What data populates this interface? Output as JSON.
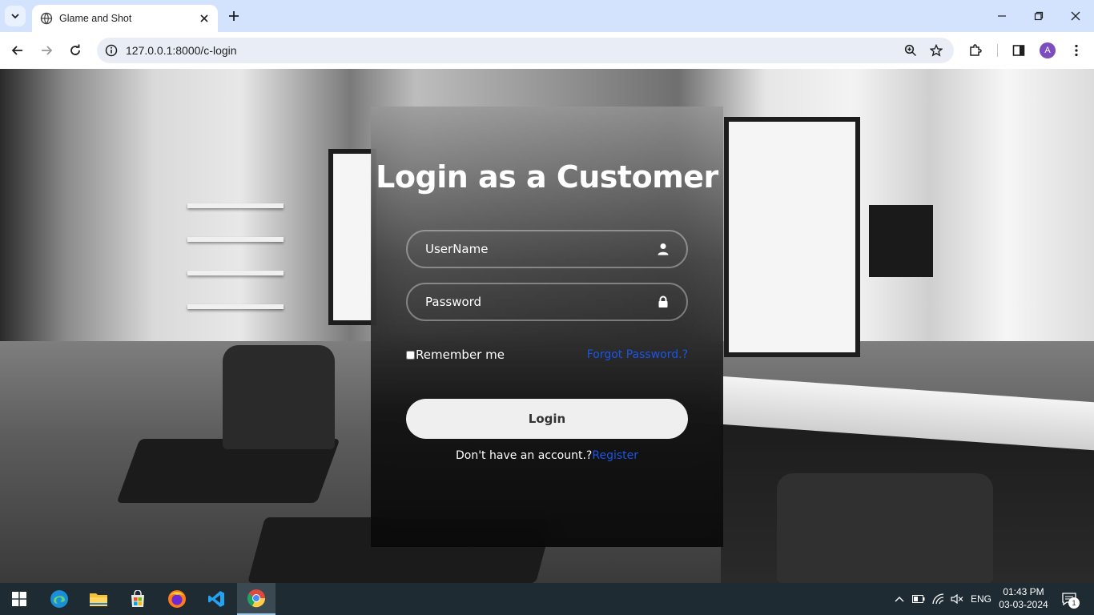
{
  "browser": {
    "tab_title": "Glame and Shot",
    "url": "127.0.0.1:8000/c-login",
    "profile_initial": "A"
  },
  "login": {
    "title": "Login as a Customer",
    "username_placeholder": "UserName",
    "password_placeholder": "Password",
    "remember_label": "Remember me",
    "forgot_label": "Forgot Password.?",
    "login_button": "Login",
    "no_account_text": "Don't have an account.?",
    "register_label": "Register"
  },
  "taskbar": {
    "language": "ENG",
    "time": "01:43 PM",
    "date": "03-03-2024",
    "notification_count": "1"
  },
  "colors": {
    "tabbar_bg": "#d3e3fd",
    "link_blue": "#1a55e8",
    "taskbar_bg": "#1e2b32"
  }
}
